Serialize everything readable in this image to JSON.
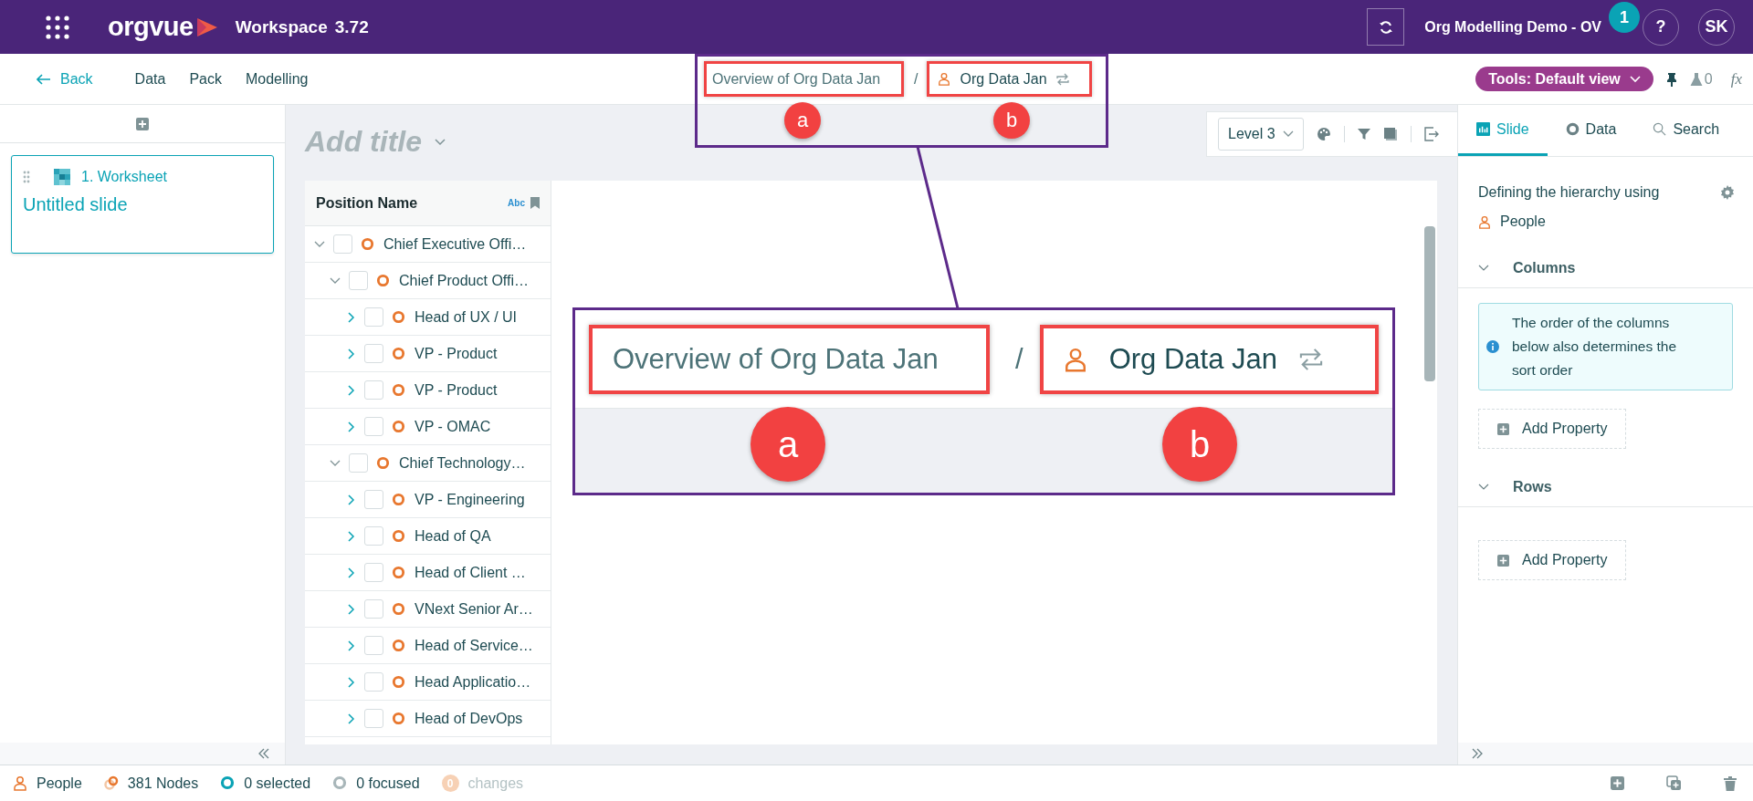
{
  "top_bar": {
    "app_name": "orgvue",
    "product": "Workspace",
    "version": "3.72",
    "project": "Org Modelling Demo - OV",
    "help": "?",
    "user_initials": "SK"
  },
  "nav": {
    "back": "Back",
    "items": [
      "Data",
      "Pack",
      "Modelling"
    ]
  },
  "breadcrumb": {
    "parent": "Overview of Org Data Jan",
    "separator": "/",
    "dataset": "Org Data Jan"
  },
  "tools": {
    "view": "Tools: Default view",
    "flask_count": "0",
    "formula": "fx"
  },
  "slides": [
    {
      "number_title": "1. Worksheet",
      "title": "Untitled slide",
      "selected": true
    }
  ],
  "canvas": {
    "title_placeholder": "Add title",
    "level": "Level 3"
  },
  "grid": {
    "column": "Position Name",
    "type_tag": "Abc",
    "rows": [
      {
        "label": "Chief Executive Offi…",
        "expanded": true,
        "checked": false,
        "children": [
          {
            "label": "Chief Product Offi…",
            "expanded": true,
            "checked": false,
            "children": [
              {
                "label": "Head of UX / UI",
                "expanded": false,
                "checked": false
              },
              {
                "label": "VP - Product",
                "expanded": false,
                "checked": false
              },
              {
                "label": "VP - Product",
                "expanded": false,
                "checked": false
              },
              {
                "label": "VP - OMAC",
                "expanded": false,
                "checked": false
              }
            ]
          },
          {
            "label": "Chief Technology…",
            "expanded": true,
            "checked": false,
            "children": [
              {
                "label": "VP - Engineering",
                "expanded": false,
                "checked": false
              },
              {
                "label": "Head of QA",
                "expanded": false,
                "checked": false
              },
              {
                "label": "Head of Client …",
                "expanded": false,
                "checked": false
              },
              {
                "label": "VNext Senior Ar…",
                "expanded": false,
                "checked": false
              },
              {
                "label": "Head of Service…",
                "expanded": false,
                "checked": false
              },
              {
                "label": "Head Applicatio…",
                "expanded": false,
                "checked": false
              },
              {
                "label": "Head of DevOps",
                "expanded": false,
                "checked": false
              }
            ]
          }
        ]
      }
    ]
  },
  "right_panel": {
    "tabs": [
      {
        "kind": "slide",
        "label": "Slide",
        "selected": true
      },
      {
        "kind": "data",
        "label": "Data",
        "selected": false
      },
      {
        "kind": "search",
        "label": "Search",
        "selected": false
      }
    ],
    "hierarchy_label": "Defining the hierarchy using",
    "hierarchy_source": "People",
    "sections": [
      {
        "title": "Columns",
        "expanded": true,
        "info": "The order of the columns below also determines the sort order",
        "add": "Add Property"
      },
      {
        "title": "Rows",
        "expanded": true,
        "add": "Add Property"
      }
    ]
  },
  "status_bar": [
    {
      "kind": "people",
      "label": "People"
    },
    {
      "kind": "nodes",
      "label": "381 Nodes"
    },
    {
      "kind": "selected",
      "label": "0 selected"
    },
    {
      "kind": "focused",
      "label": "0 focused"
    },
    {
      "kind": "changes",
      "count": "0",
      "label": "changes"
    }
  ],
  "annotations": {
    "notification_badge": "1",
    "markers": [
      "a",
      "b"
    ],
    "zoom_markers": [
      "a",
      "b"
    ],
    "zoom": {
      "parent": "Overview of Org Data Jan",
      "separator": "/",
      "dataset": "Org Data Jan"
    }
  }
}
